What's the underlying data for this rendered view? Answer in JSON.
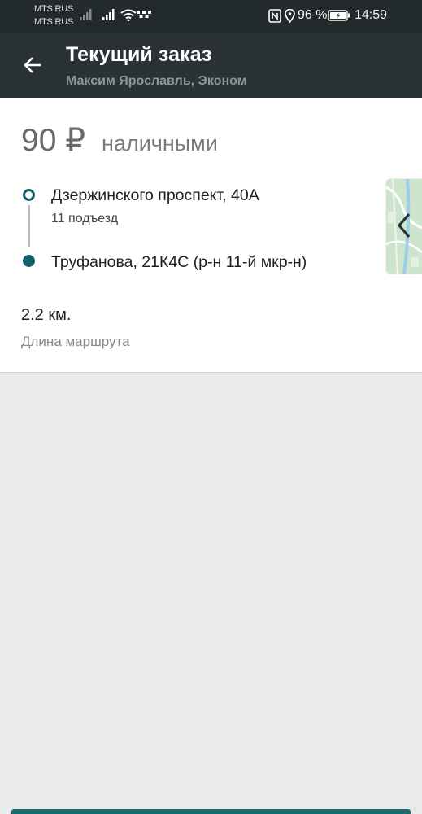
{
  "status_bar": {
    "operator_1": "MTS RUS",
    "operator_2": "MTS RUS",
    "battery": "96 %",
    "time": "14:59"
  },
  "app_bar": {
    "title": "Текущий заказ",
    "subtitle": "Максим Ярославль, Эконом",
    "back_icon": "arrow-left-icon"
  },
  "order": {
    "price": "90 ₽",
    "payment_method": "наличными",
    "route": {
      "from": "Дзержинского проспект, 40А",
      "from_entrance": "11 подъезд",
      "to": "Труфанова, 21К4С (р-н 11-й мкр-н)"
    },
    "distance_value": "2.2 км.",
    "distance_label": "Длина маршрута"
  },
  "colors": {
    "app_bar": "#2a3235",
    "accent": "#11606a",
    "background": "#e9eaec"
  }
}
